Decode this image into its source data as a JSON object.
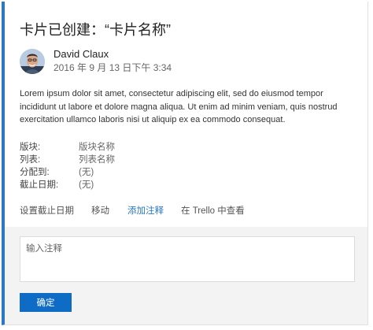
{
  "card": {
    "title": "卡片已创建：“卡片名称”",
    "author": "David Claux",
    "timestamp": "2016 年 9 月 13 日下午 3:34",
    "body": "Lorem ipsum dolor sit amet, consectetur adipiscing elit, sed do eiusmod tempor incididunt ut labore et dolore magna aliqua. Ut enim ad minim veniam, quis nostrud exercitation ullamco laboris nisi ut aliquip ex ea commodo consequat.",
    "fields": [
      {
        "label": "版块:",
        "value": "版块名称"
      },
      {
        "label": "列表:",
        "value": "列表名称"
      },
      {
        "label": "分配到:",
        "value": "(无)"
      },
      {
        "label": "截止日期:",
        "value": "(无)"
      }
    ]
  },
  "actions": {
    "set_due_date": "设置截止日期",
    "move": "移动",
    "add_comment": "添加注释",
    "view_in_trello": "在 Trello 中查看"
  },
  "comment": {
    "placeholder": "输入注释",
    "value": "",
    "submit_label": "确定"
  },
  "colors": {
    "accent": "#2b79c2",
    "button": "#0f6cc6",
    "panel": "#f3f3f3"
  },
  "icons": {
    "avatar": "user-avatar"
  }
}
